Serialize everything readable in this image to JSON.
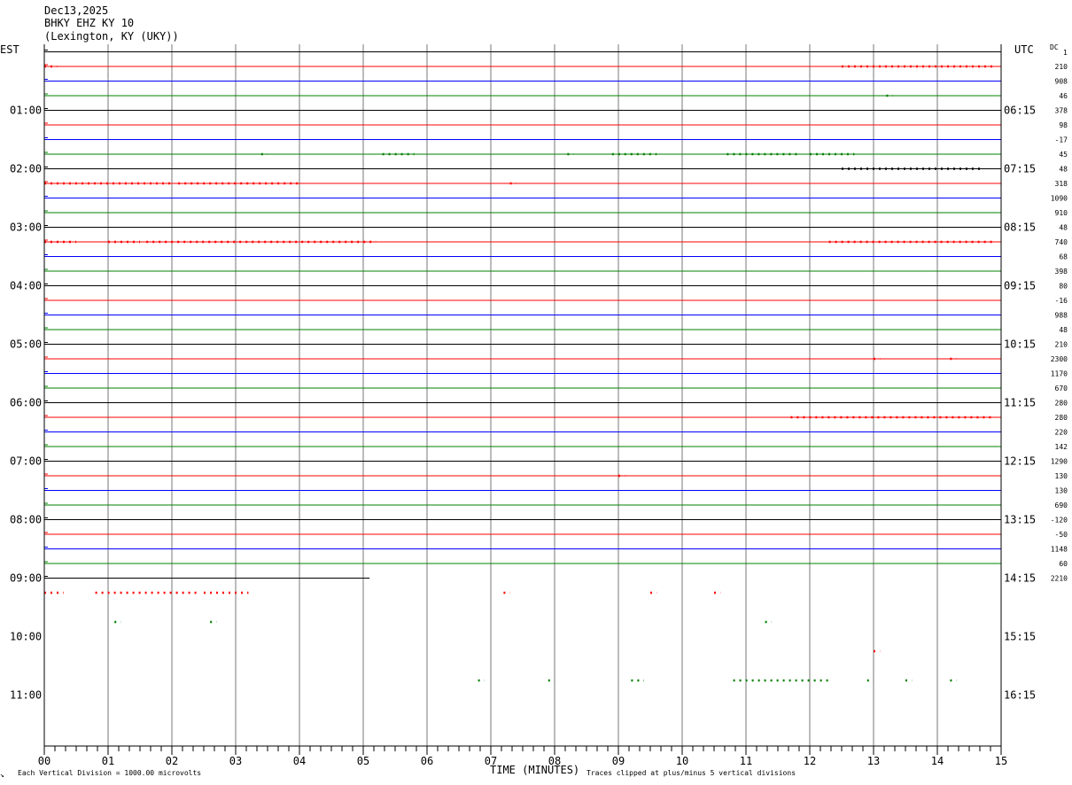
{
  "header": {
    "date": "Dec13,2025",
    "station": "BHKY EHZ KY 10",
    "location": "(Lexington, KY (UKY))",
    "left_timezone": "EST",
    "right_timezone": "UTC",
    "dc_label": "DC"
  },
  "footer": {
    "scale_note": "Each Vertical Division = 1000.00 microvolts",
    "xlabel": "TIME (MINUTES)",
    "clip_note": "Traces clipped at plus/minus 5 vertical divisions",
    "mark": "↘"
  },
  "chart_data": {
    "type": "line",
    "title": "BHKY EHZ KY 10",
    "xlabel": "TIME (MINUTES)",
    "x_ticks": [
      "00",
      "01",
      "02",
      "03",
      "04",
      "05",
      "06",
      "07",
      "08",
      "09",
      "10",
      "11",
      "12",
      "13",
      "14",
      "15"
    ],
    "xlim": [
      0,
      15
    ],
    "grid": true,
    "trace_colors": [
      "#000000",
      "#ff0000",
      "#0000ff",
      "#008000"
    ],
    "rows_total": 48,
    "est_hour_labels": [
      "01:00",
      "02:00",
      "03:00",
      "04:00",
      "05:00",
      "06:00",
      "07:00",
      "08:00",
      "09:00",
      "10:00",
      "11:00"
    ],
    "utc_hour_labels": [
      "06:15",
      "07:15",
      "08:15",
      "09:15",
      "10:15",
      "11:15",
      "12:15",
      "13:15",
      "14:15",
      "15:15",
      "16:15"
    ],
    "dc_top": "1",
    "dc_offsets": [
      "210",
      "908",
      "46",
      "378",
      "98",
      "-17",
      "45",
      "48",
      "318",
      "1090",
      "910",
      "48",
      "740",
      "68",
      "398",
      "80",
      "-16",
      "988",
      "48",
      "210",
      "2300",
      "1170",
      "670",
      "280",
      "280",
      "220",
      "142",
      "1290",
      "130",
      "130",
      "690",
      "-120",
      "-50",
      "1148",
      "60",
      "2210"
    ],
    "last_trace_end_minute": 5.1,
    "events": [
      {
        "row": 1,
        "ranges": [
          [
            0,
            0.2
          ],
          [
            12.5,
            14.9
          ]
        ]
      },
      {
        "row": 3,
        "ranges": [
          [
            13.2,
            13.3
          ]
        ]
      },
      {
        "row": 7,
        "ranges": [
          [
            3.4,
            3.5
          ],
          [
            5.3,
            5.8
          ],
          [
            8.2,
            8.3
          ],
          [
            8.9,
            9.6
          ],
          [
            10.7,
            11.8
          ],
          [
            12.0,
            12.7
          ]
        ]
      },
      {
        "row": 8,
        "ranges": [
          [
            12.5,
            14.7
          ]
        ]
      },
      {
        "row": 9,
        "ranges": [
          [
            0,
            2.0
          ],
          [
            2.1,
            4.0
          ],
          [
            7.3,
            7.4
          ]
        ]
      },
      {
        "row": 13,
        "ranges": [
          [
            0,
            0.5
          ],
          [
            1.0,
            1.5
          ],
          [
            1.6,
            5.2
          ],
          [
            12.3,
            14.9
          ]
        ]
      },
      {
        "row": 21,
        "ranges": [
          [
            13.0,
            13.1
          ],
          [
            14.2,
            14.3
          ]
        ]
      },
      {
        "row": 25,
        "ranges": [
          [
            11.7,
            14.9
          ]
        ]
      },
      {
        "row": 29,
        "ranges": [
          [
            9.0,
            9.1
          ]
        ]
      },
      {
        "row": 37,
        "ranges": [
          [
            0,
            0.3
          ],
          [
            0.8,
            2.4
          ],
          [
            2.5,
            3.2
          ],
          [
            7.2,
            7.3
          ],
          [
            9.5,
            9.6
          ],
          [
            10.5,
            10.6
          ]
        ]
      },
      {
        "row": 39,
        "ranges": [
          [
            1.1,
            1.2
          ],
          [
            2.6,
            2.7
          ],
          [
            11.3,
            11.4
          ]
        ]
      },
      {
        "row": 41,
        "ranges": [
          [
            13.0,
            13.1
          ]
        ]
      },
      {
        "row": 43,
        "ranges": [
          [
            6.8,
            6.9
          ],
          [
            7.9,
            8.0
          ],
          [
            9.2,
            9.4
          ],
          [
            10.8,
            12.3
          ],
          [
            12.9,
            13.0
          ],
          [
            13.5,
            13.6
          ],
          [
            14.2,
            14.3
          ]
        ]
      }
    ]
  }
}
